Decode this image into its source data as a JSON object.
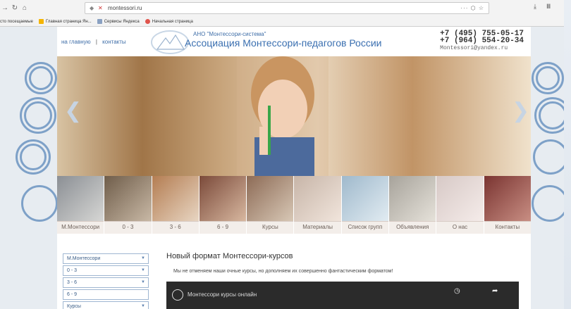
{
  "browser": {
    "url": "montessori.ru",
    "bookmarks": [
      {
        "label": "сто посещаемые",
        "color": "#b9b9b9"
      },
      {
        "label": "Главная страница Ян...",
        "color": "#f4b400"
      },
      {
        "label": "Сервисы Яндекса",
        "color": "#8aa1c2"
      },
      {
        "label": "Начальная страница",
        "color": "#e0544c"
      }
    ],
    "more_icon": "ellipsis-icon",
    "right_icons": [
      "download-icon",
      "library-icon"
    ]
  },
  "site": {
    "top_links": {
      "home": "на главную",
      "separator": "|",
      "contacts": "контакты"
    },
    "org_sub": "АНО \"Монтессори-система\"",
    "org_title": "Ассоциация Монтессори-педагогов России",
    "phones": [
      "+7 (495) 755-05-17",
      "+7 (964) 554-20-34"
    ],
    "email": "Montessori@yandex.ru",
    "thumbs": [
      {
        "label": "М.Монтессори",
        "c1": "#8b8f94",
        "c2": "#d7d7d5"
      },
      {
        "label": "0 - 3",
        "c1": "#6f5d4a",
        "c2": "#c9b9a6"
      },
      {
        "label": "3 - 6",
        "c1": "#b47d52",
        "c2": "#e8d6c3"
      },
      {
        "label": "6 - 9",
        "c1": "#7b4a3a",
        "c2": "#d8b8a0"
      },
      {
        "label": "Курсы",
        "c1": "#8d6b56",
        "c2": "#d8c8b6"
      },
      {
        "label": "Материалы",
        "c1": "#c7b5a8",
        "c2": "#f1e5dc"
      },
      {
        "label": "Список групп",
        "c1": "#9fb9cc",
        "c2": "#e2ecf2"
      },
      {
        "label": "Объявления",
        "c1": "#a7a39b",
        "c2": "#e6e2da"
      },
      {
        "label": "О нас",
        "c1": "#d7c9c6",
        "c2": "#f5ecea"
      },
      {
        "label": "Контакты",
        "c1": "#7a3431",
        "c2": "#c98f84"
      }
    ],
    "sidebar_menu": [
      {
        "label": "М.Монтессори",
        "dropdown": true
      },
      {
        "label": "0 - 3",
        "dropdown": true
      },
      {
        "label": "3 - 6",
        "dropdown": true
      },
      {
        "label": "6 - 9",
        "dropdown": false
      },
      {
        "label": "Курсы",
        "dropdown": true
      }
    ],
    "content_title": "Новый формат Монтессори-курсов",
    "content_text": "Мы не отменяем наши очные курсы, но дополняем их совершенно фантастическим форматом!",
    "video_title": "Монтессори курсы онлайн"
  }
}
